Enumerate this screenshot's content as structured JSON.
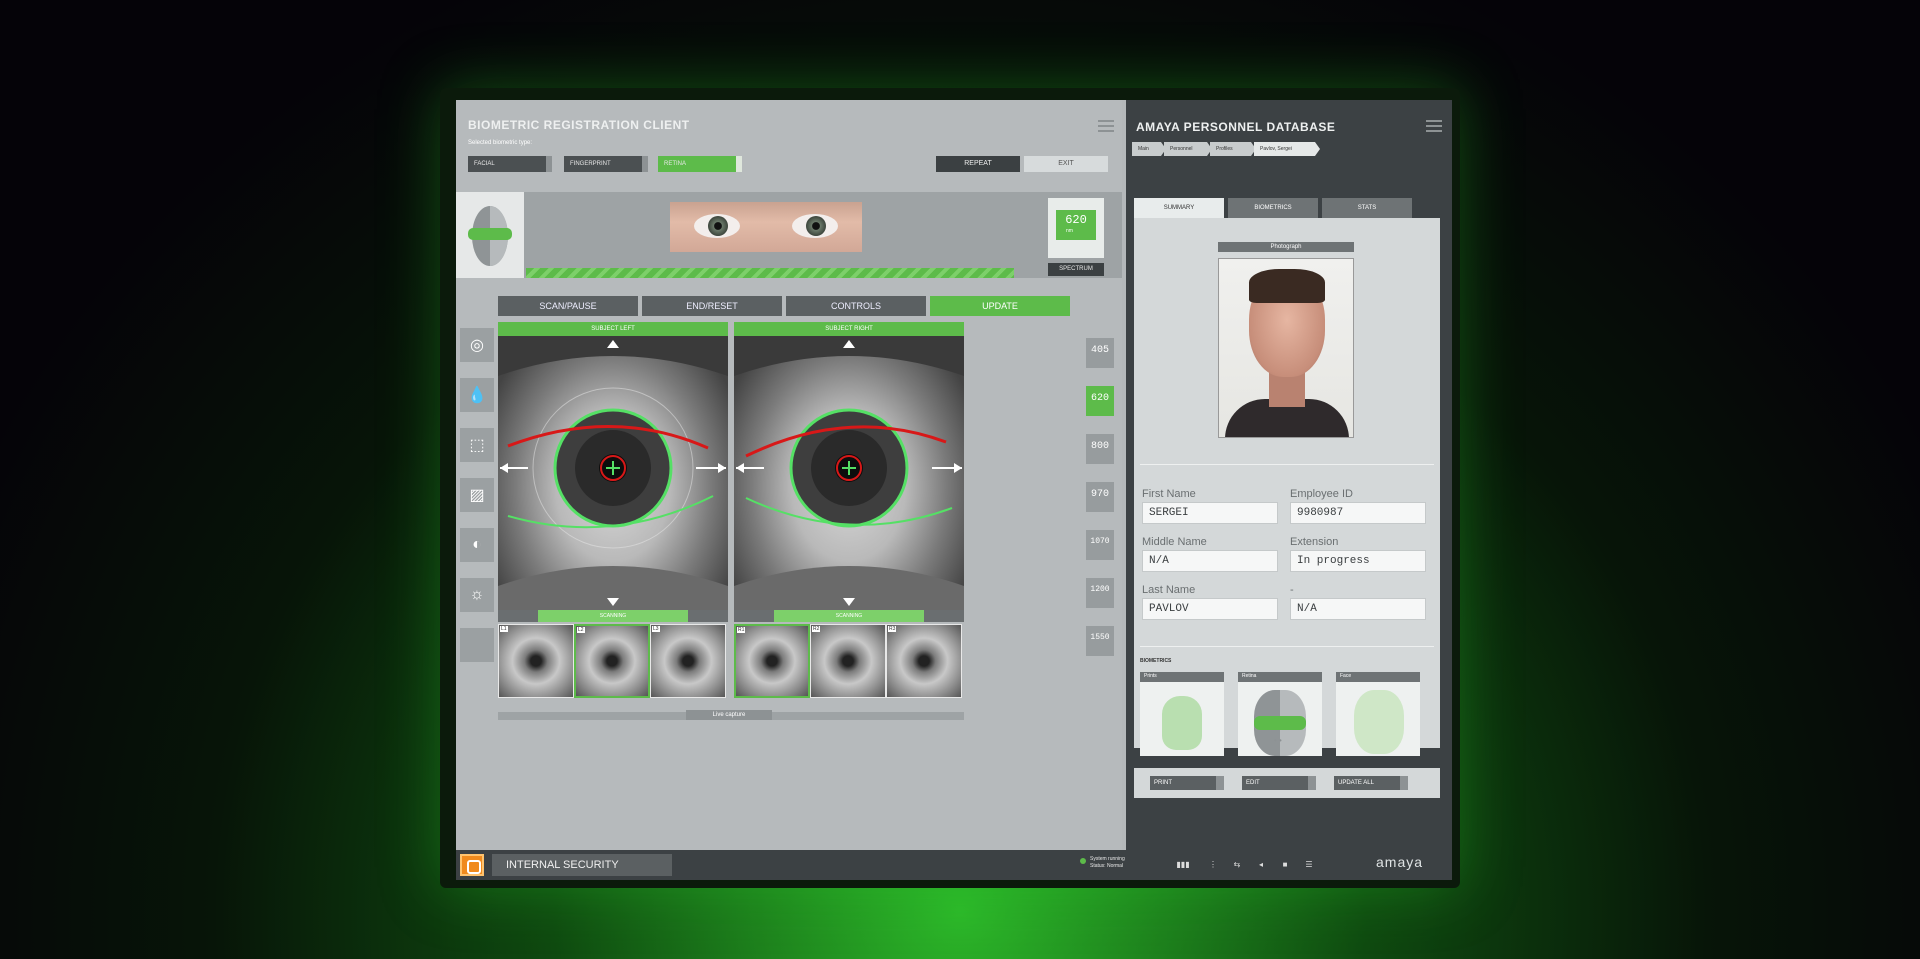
{
  "client": {
    "title": "BIOMETRIC REGISTRATION CLIENT",
    "subtitle": "Selected biometric type:",
    "types": [
      "FACIAL",
      "FINGERPRINT",
      "RETINA"
    ],
    "actions": [
      "REPEAT",
      "EXIT"
    ],
    "spectrum": {
      "value": "620",
      "unit": "nm",
      "label": "SPECTRUM"
    },
    "control_tabs": [
      "SCAN/PAUSE",
      "END/RESET",
      "CONTROLS",
      "UPDATE"
    ],
    "subject_left": "SUBJECT LEFT",
    "subject_right": "SUBJECT RIGHT",
    "scan_status": "SCANNING",
    "wavelengths": [
      "405",
      "620",
      "800",
      "970",
      "1070",
      "1200",
      "1550"
    ],
    "wavelength_unit": "nm",
    "live_capture": "Live capture",
    "thumb_indexes": [
      "L1",
      "L2",
      "L3",
      "R1",
      "R2",
      "R3"
    ]
  },
  "database": {
    "title": "AMAYA PERSONNEL DATABASE",
    "breadcrumb": [
      "Main",
      "Personnel",
      "Profiles",
      "Pavlov, Sergei"
    ],
    "tabs": [
      "SUMMARY",
      "BIOMETRICS",
      "STATS"
    ],
    "photo_label": "Photograph",
    "fields": {
      "first_name": {
        "label": "First Name",
        "value": "SERGEI"
      },
      "employee_id": {
        "label": "Employee ID",
        "value": "9980987"
      },
      "middle_name": {
        "label": "Middle Name",
        "value": "N/A"
      },
      "extension": {
        "label": "Extension",
        "value": "In progress"
      },
      "last_name": {
        "label": "Last Name",
        "value": "PAVLOV"
      },
      "blank": {
        "label": "-",
        "value": "N/A"
      }
    },
    "biometrics_label": "BIOMETRICS",
    "bio_cards": [
      "Prints",
      "Retina",
      "Face"
    ],
    "buttons": [
      "PRINT",
      "EDIT",
      "UPDATE ALL"
    ]
  },
  "status_bar": {
    "section": "INTERNAL SECURITY",
    "system_line1": "System running",
    "system_line2": "Status: Normal",
    "brand": "amaya"
  },
  "colors": {
    "accent": "#5dbb4a",
    "dark": "#3c4144",
    "warning": "#f08a1d"
  }
}
